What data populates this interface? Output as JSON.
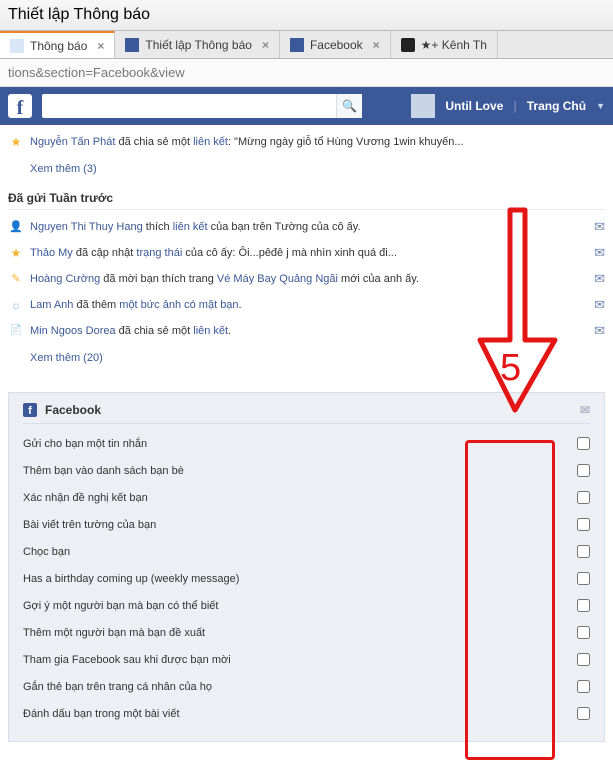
{
  "window": {
    "title": "Thiết lập Thông báo"
  },
  "tabs": [
    {
      "label": "Thông báo",
      "active": true,
      "close": "×"
    },
    {
      "label": "Thiết lập Thông báo",
      "close": "×"
    },
    {
      "label": "Facebook",
      "close": "×"
    },
    {
      "label": "★+ Kênh Th",
      "close": ""
    }
  ],
  "urlbar": "tions&section=Facebook&view",
  "fb": {
    "username": "Until Love",
    "home": "Trang Chủ",
    "search_placeholder": ""
  },
  "top_notif": {
    "person": "Nguyễn Tấn Phát",
    "mid": " đã chia sẻ một ",
    "link": "liên kết",
    "rest": ":  \"Mừng ngày giỗ tổ Hùng Vương 1win khuyến..."
  },
  "see_more_1": "Xem thêm (3)",
  "section_week": "Đã gửi Tuần trước",
  "week_notifs": [
    {
      "ico": "ico-card",
      "person": "Nguyen Thi Thuy Hang",
      "mid": " thích ",
      "link": "liên kết",
      "rest": " của bạn trên Tường của cô ấy."
    },
    {
      "ico": "ico-star",
      "person": "Thảo My",
      "mid": " đã cập nhật ",
      "link": "trạng thái",
      "rest": " của cô ấy: Ôi...pêđê j mà nhìn xinh quá đi..."
    },
    {
      "ico": "ico-msg",
      "person": "Hoàng Cường",
      "mid": " đã mời bạn thích trang ",
      "link": "Vé Máy Bay Quảng Ngãi",
      "rest": " mới của anh ấy."
    },
    {
      "ico": "ico-bulb",
      "person": "Lam Anh",
      "mid": " đã thêm ",
      "link": "một bức ảnh có mặt bạn",
      "rest": "."
    },
    {
      "ico": "ico-page",
      "person": "Min Ngoos Dorea",
      "mid": " đã chia sẻ một ",
      "link": "liên kết",
      "rest": "."
    }
  ],
  "see_more_2": "Xem thêm (20)",
  "settings": {
    "header": "Facebook",
    "rows": [
      "Gửi cho bạn một tin nhắn",
      "Thêm bạn vào danh sách bạn bè",
      "Xác nhận đề nghị kết bạn",
      "Bài viết trên tường của bạn",
      "Chọc bạn",
      "Has a birthday coming up (weekly message)",
      "Gợi ý một người bạn mà bạn có thể biết",
      "Thêm một người bạn mà bạn đề xuất",
      "Tham gia Facebook sau khi được bạn mời",
      "Gắn thẻ bạn trên trang cá nhân của họ",
      "Đánh dấu bạn trong một bài viết"
    ]
  },
  "annotation": {
    "label": "5"
  }
}
